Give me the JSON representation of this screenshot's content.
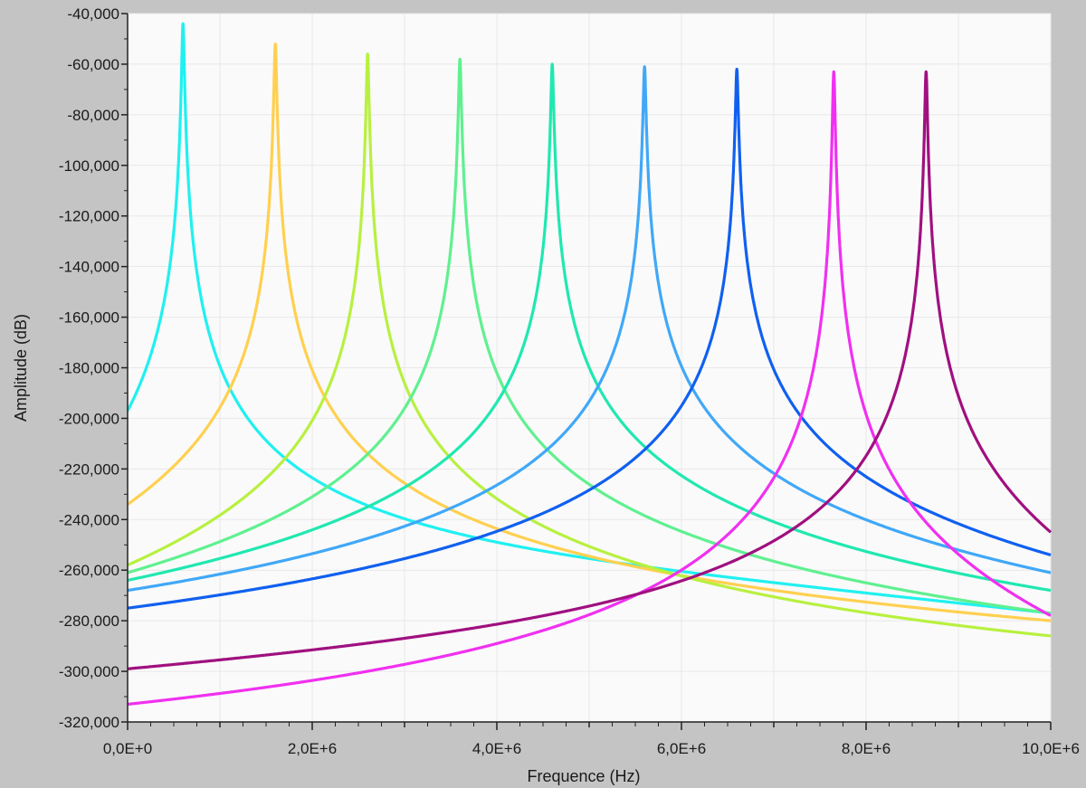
{
  "chart_data": {
    "type": "line",
    "title": "",
    "xlabel": "Frequence (Hz)",
    "ylabel": "Amplitude (dB)",
    "xlim": [
      0,
      10000000
    ],
    "ylim": [
      -320,
      -40
    ],
    "x_ticks": [
      0,
      1000000,
      2000000,
      3000000,
      4000000,
      5000000,
      6000000,
      7000000,
      8000000,
      9000000,
      10000000
    ],
    "x_tick_labels": [
      "0,0E+0",
      "",
      "2,0E+6",
      "",
      "4,0E+6",
      "",
      "6,0E+6",
      "",
      "8,0E+6",
      "",
      "10,0E+6"
    ],
    "y_ticks": [
      -40,
      -60,
      -80,
      -100,
      -120,
      -140,
      -160,
      -180,
      -200,
      -220,
      -240,
      -260,
      -280,
      -300,
      -320
    ],
    "y_tick_labels": [
      "-40,000",
      "-60,000",
      "-80,000",
      "-100,000",
      "-120,000",
      "-140,000",
      "-160,000",
      "-180,000",
      "-200,000",
      "-220,000",
      "-240,000",
      "-260,000",
      "-280,000",
      "-300,000",
      "-320,000"
    ],
    "grid": true,
    "legend": "none",
    "plot_background": "#fafafa",
    "series": [
      {
        "color": "#20f0f0",
        "peak_x": 600000,
        "peak_y": -44,
        "start_y": -197,
        "end_y": -277
      },
      {
        "color": "#ffd050",
        "peak_x": 1600000,
        "peak_y": -52,
        "start_y": -234,
        "end_y": -280
      },
      {
        "color": "#b8f040",
        "peak_x": 2600000,
        "peak_y": -56,
        "start_y": -258,
        "end_y": -286
      },
      {
        "color": "#60f090",
        "peak_x": 3600000,
        "peak_y": -58,
        "start_y": -261,
        "end_y": -277
      },
      {
        "color": "#20e8b0",
        "peak_x": 4600000,
        "peak_y": -60,
        "start_y": -264,
        "end_y": -268
      },
      {
        "color": "#40a8f8",
        "peak_x": 5600000,
        "peak_y": -61,
        "start_y": -268,
        "end_y": -261
      },
      {
        "color": "#1060f0",
        "peak_x": 6600000,
        "peak_y": -62,
        "start_y": -275,
        "end_y": -254
      },
      {
        "color": "#f030f0",
        "peak_x": 7650000,
        "peak_y": -63,
        "start_y": -313,
        "end_y": -278
      },
      {
        "color": "#a01080",
        "peak_x": 8650000,
        "peak_y": -63,
        "start_y": -299,
        "end_y": -245
      }
    ]
  }
}
